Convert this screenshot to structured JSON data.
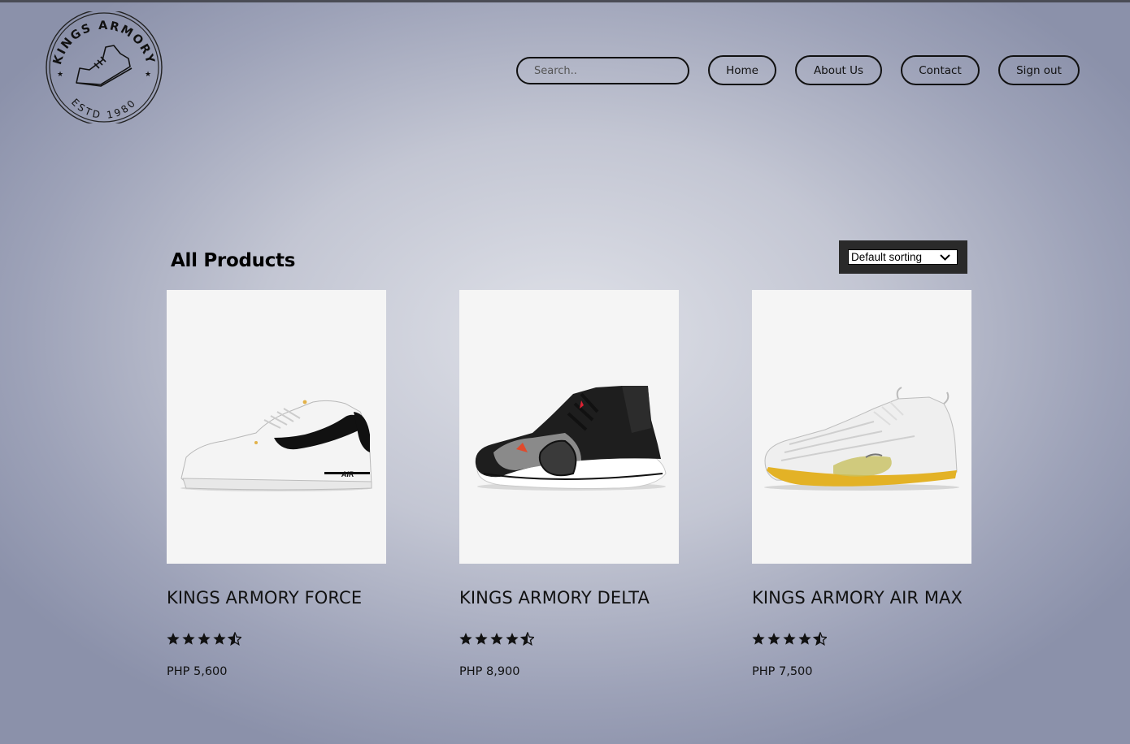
{
  "brand": {
    "logo_top_text": "KINGS ARMORY",
    "logo_bottom_text": "ESTD 1980"
  },
  "nav": {
    "search_placeholder": "Search..",
    "items": [
      {
        "label": "Home"
      },
      {
        "label": "About Us"
      },
      {
        "label": "Contact"
      },
      {
        "label": "Sign out"
      }
    ]
  },
  "section": {
    "title": "All Products",
    "sort_selected": "Default sorting"
  },
  "products": [
    {
      "name": "KINGS ARMORY FORCE",
      "rating": 4.5,
      "price": "PHP 5,600",
      "image_icon": "white-sneaker-image"
    },
    {
      "name": "KINGS ARMORY DELTA",
      "rating": 4.5,
      "price": "PHP 8,900",
      "image_icon": "black-high-top-sneaker-image"
    },
    {
      "name": "KINGS ARMORY AIR MAX",
      "rating": 4.5,
      "price": "PHP 7,500",
      "image_icon": "white-yellow-sneaker-image"
    }
  ],
  "colors": {
    "background_center": "#dfe1e8",
    "background_edge": "#8b91aa",
    "sort_box": "#2a2a2a",
    "accent_yellow": "#e3b226"
  }
}
